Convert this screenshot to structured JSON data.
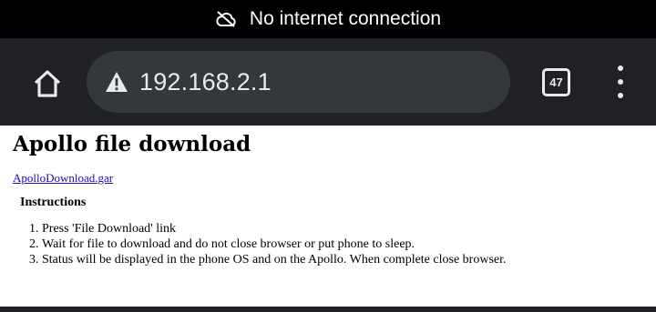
{
  "status_bar": {
    "text": "No internet connection",
    "icon": "cloud-off-icon"
  },
  "toolbar": {
    "home_icon": "home-icon",
    "security_icon": "warning-icon",
    "url": "192.168.2.1",
    "tab_count": "47",
    "menu_icon": "more-vert-icon"
  },
  "page": {
    "title": "Apollo file download",
    "file_link": "ApolloDownload.gar",
    "instructions_heading": "Instructions",
    "instructions": [
      "Press 'File Download' link",
      "Wait for file to download and do not close browser or put phone to sleep.",
      "Status will be displayed in the phone OS and on the Apollo. When complete close browser."
    ]
  },
  "colors": {
    "status_bar_bg": "#000000",
    "toolbar_bg": "#202124",
    "omnibox_bg": "#34373c",
    "toolbar_text": "#e8eaed",
    "link": "#1a0dab"
  }
}
